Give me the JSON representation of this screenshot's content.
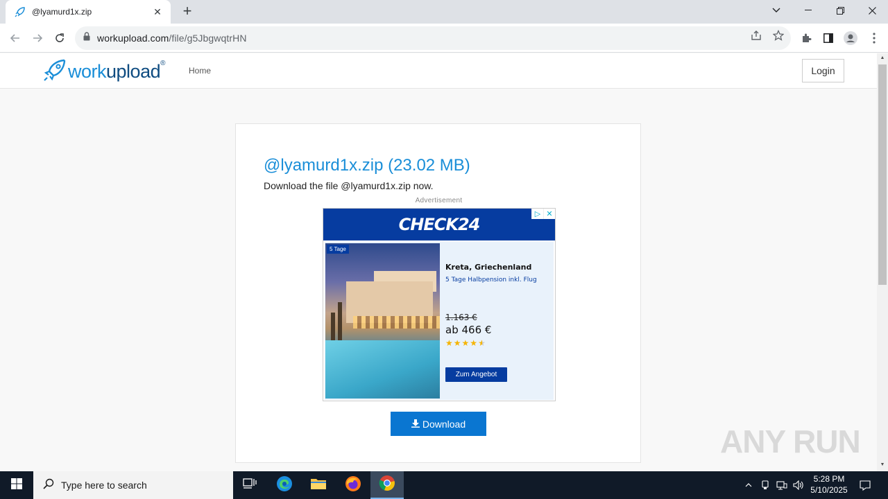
{
  "browser": {
    "tab_title": "@lyamurd1x.zip",
    "url_host": "workupload.com",
    "url_path": "/file/g5JbgwqtrHN"
  },
  "site": {
    "logo_text_prefix": "work",
    "logo_text_suffix": "upload",
    "logo_reg": "®",
    "nav_home": "Home",
    "login_label": "Login"
  },
  "file": {
    "title": "@lyamurd1x.zip (23.02 MB)",
    "description": "Download the file @lyamurd1x.zip now.",
    "download_label": "Download"
  },
  "ad": {
    "label": "Advertisement",
    "brand": "CHECK24",
    "photo_tag": "5 Tage",
    "title": "Kreta, Griechenland",
    "subtitle": "5 Tage Halbpension inkl. Flug",
    "old_price": "1.163 €",
    "price": "ab 466 €",
    "rating_stars": 4.5,
    "cta": "Zum Angebot",
    "accent": "#063ca0"
  },
  "watermark": "ANY RUN",
  "taskbar": {
    "search_placeholder": "Type here to search",
    "time": "5:28 PM",
    "date": "5/10/2025"
  }
}
